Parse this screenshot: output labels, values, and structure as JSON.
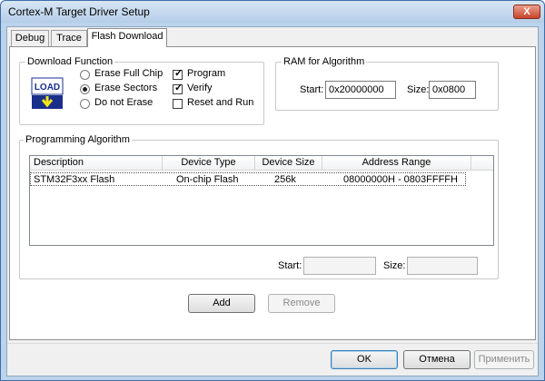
{
  "window": {
    "title": "Cortex-M Target Driver Setup",
    "close_glyph": "X"
  },
  "tabs": [
    {
      "label": "Debug",
      "active": false
    },
    {
      "label": "Trace",
      "active": false
    },
    {
      "label": "Flash Download",
      "active": true
    }
  ],
  "download_function": {
    "title": "Download Function",
    "icon_text": "LOAD",
    "radios": [
      {
        "label": "Erase Full Chip",
        "selected": false
      },
      {
        "label": "Erase Sectors",
        "selected": true
      },
      {
        "label": "Do not Erase",
        "selected": false
      }
    ],
    "checkboxes": [
      {
        "label": "Program",
        "checked": true
      },
      {
        "label": "Verify",
        "checked": true
      },
      {
        "label": "Reset and Run",
        "checked": false
      }
    ]
  },
  "ram": {
    "title": "RAM for Algorithm",
    "start_label": "Start:",
    "start_value": "0x20000000",
    "size_label": "Size:",
    "size_value": "0x0800"
  },
  "programming_algorithm": {
    "title": "Programming Algorithm",
    "columns": [
      "Description",
      "Device Type",
      "Device Size",
      "Address Range"
    ],
    "rows": [
      {
        "description": "STM32F3xx Flash",
        "device_type": "On-chip Flash",
        "device_size": "256k",
        "address_range": "08000000H - 0803FFFFH"
      }
    ],
    "start_label": "Start:",
    "start_value": "",
    "size_label": "Size:",
    "size_value": ""
  },
  "buttons": {
    "add": "Add",
    "remove": "Remove",
    "ok": "OK",
    "cancel": "Отмена",
    "apply": "Применить"
  },
  "colors": {
    "title_bar": "#bcd3ec",
    "close_button": "#c7432a",
    "page_bg": "#ffffff",
    "dialog_bg": "#f0f0f0"
  }
}
